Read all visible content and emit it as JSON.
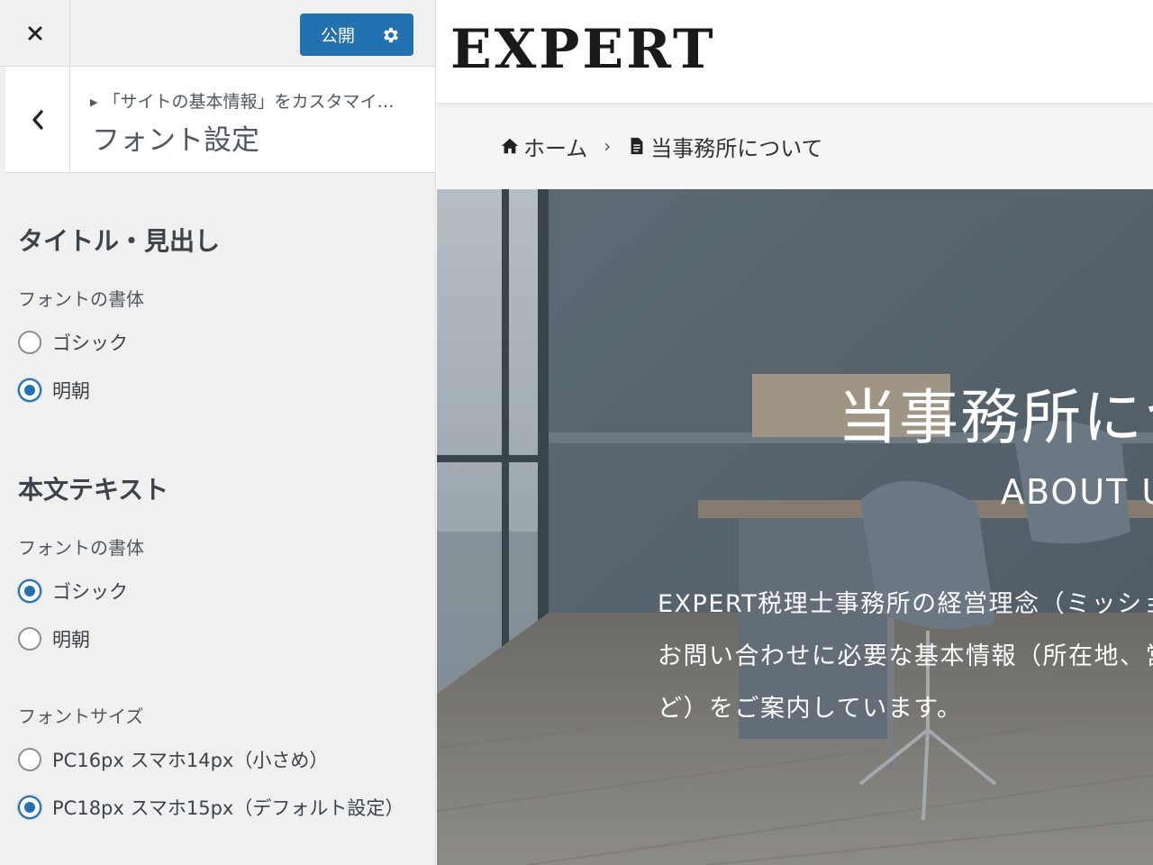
{
  "topbar": {
    "publish_label": "公開"
  },
  "section": {
    "breadcrumb": "「サイトの基本情報」をカスタマイ…",
    "title": "フォント設定"
  },
  "headings": {
    "title": "タイトル・見出し",
    "font_label": "フォントの書体",
    "options": [
      {
        "label": "ゴシック",
        "checked": false
      },
      {
        "label": "明朝",
        "checked": true
      }
    ]
  },
  "body_text": {
    "title": "本文テキスト",
    "font_label": "フォントの書体",
    "options": [
      {
        "label": "ゴシック",
        "checked": true
      },
      {
        "label": "明朝",
        "checked": false
      }
    ],
    "size_label": "フォントサイズ",
    "size_options": [
      {
        "label": "PC16px スマホ14px（小さめ）",
        "checked": false
      },
      {
        "label": "PC18px スマホ15px（デフォルト設定）",
        "checked": true
      }
    ]
  },
  "preview": {
    "logo": "EXPERT",
    "breadcrumb": {
      "home": "ホーム",
      "separator": "›",
      "current": "当事務所について"
    },
    "hero": {
      "title": "当事務所について",
      "subtitle": "ABOUT US",
      "text": "EXPERT税理士事務所の経営理念（ミッション）と、お問い合わせに必要な基本情報（所在地、営業時間など）をご案内しています。"
    }
  },
  "colors": {
    "accent": "#2271b1",
    "sidebar_bg": "#f0f0f1"
  }
}
